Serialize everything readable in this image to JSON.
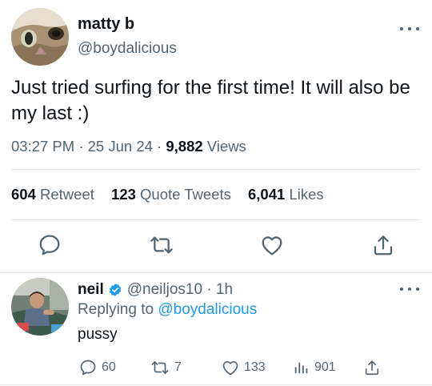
{
  "main_tweet": {
    "display_name": "matty b",
    "handle": "@boydalicious",
    "text": "Just tried surfing for the first time! It will also be my last :)",
    "time": "03:27 PM",
    "separator": "·",
    "date": "25 Jun 24",
    "views_count": "9,882",
    "views_label": "Views",
    "retweets_count": "604",
    "retweets_label": "Retweet",
    "quotes_count": "123",
    "quotes_label": "Quote Tweets",
    "likes_count": "6,041",
    "likes_label": "Likes",
    "avatar_icon": "cat-face-avatar"
  },
  "reply_tweet": {
    "display_name": "neil",
    "verified": true,
    "handle": "@neiljos10",
    "separator": "·",
    "time": "1h",
    "replying_prefix": "Replying to",
    "replying_to": "@boydalicious",
    "text": "pussy",
    "reply_count": "60",
    "retweet_count": "7",
    "like_count": "133",
    "view_count": "901",
    "avatar_icon": "person-in-car-avatar"
  },
  "colors": {
    "text_primary": "#0f1419",
    "text_secondary": "#536471",
    "accent": "#1d9bf0",
    "divider": "#e1e6ea"
  },
  "icons": {
    "more": "more-dots-icon",
    "reply": "reply-bubble-icon",
    "retweet": "retweet-arrows-icon",
    "like": "heart-icon",
    "share": "share-upload-icon",
    "views": "views-bars-icon",
    "verified": "verified-badge-icon"
  }
}
